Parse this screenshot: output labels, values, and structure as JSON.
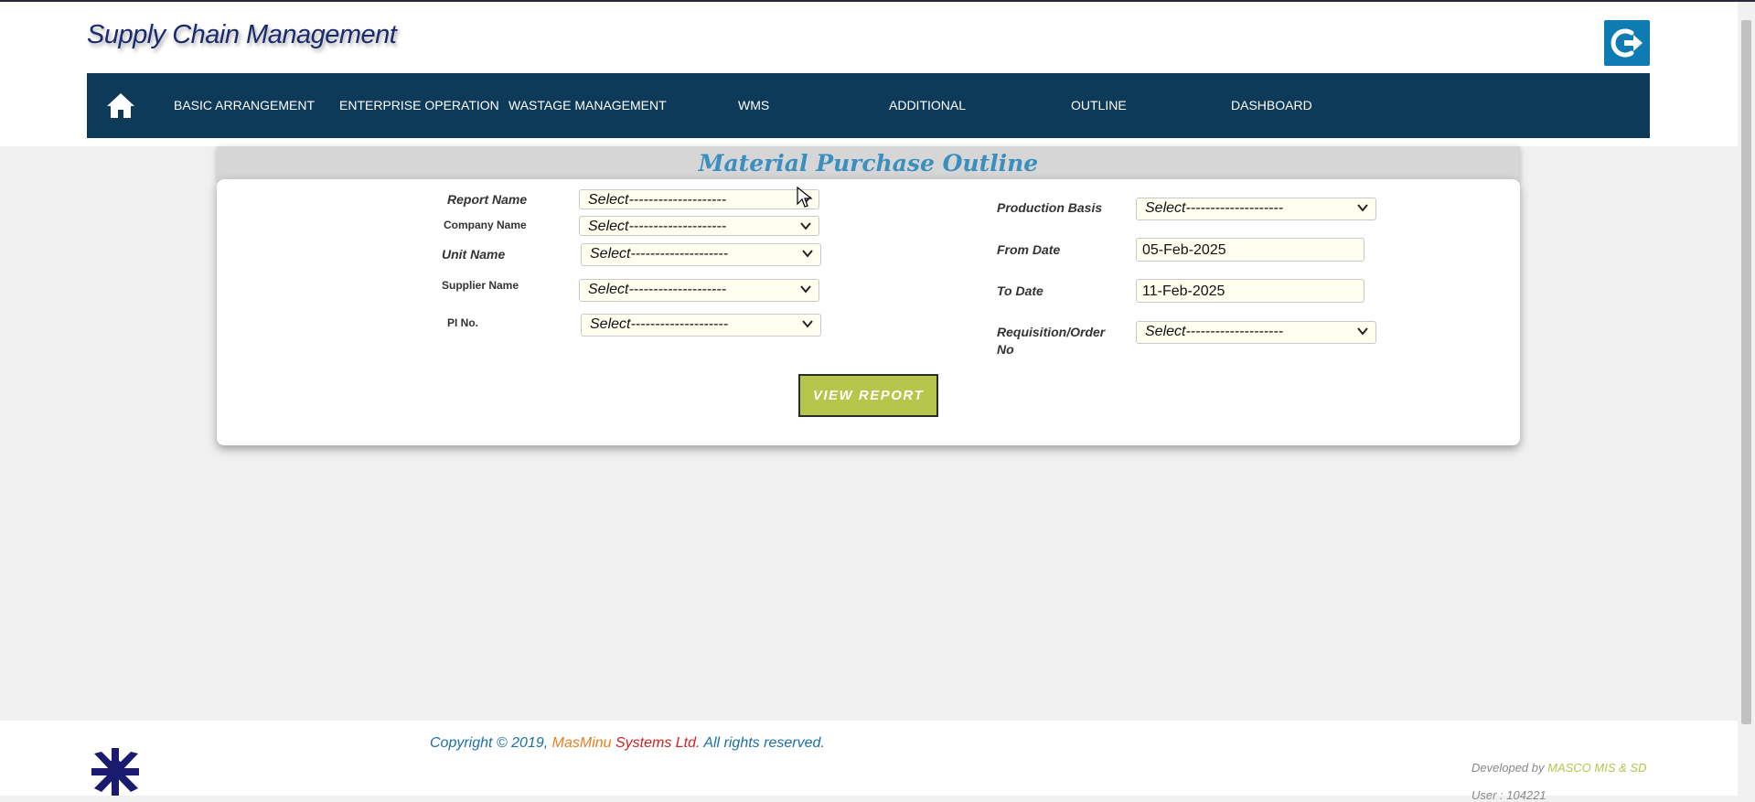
{
  "app": {
    "title": "Supply Chain Management"
  },
  "nav": {
    "items": [
      {
        "label": "BASIC ARRANGEMENT"
      },
      {
        "label": "ENTERPRISE OPERATION"
      },
      {
        "label": "WASTAGE MANAGEMENT"
      },
      {
        "label": "WMS"
      },
      {
        "label": "ADDITIONAL"
      },
      {
        "label": "OUTLINE"
      },
      {
        "label": "DASHBOARD"
      }
    ]
  },
  "form": {
    "title": "Material Purchase Outline",
    "left_fields": [
      {
        "label": "Report Name",
        "value": "Select--------------------"
      },
      {
        "label": "Company Name",
        "value": "Select--------------------"
      },
      {
        "label": "Unit Name",
        "value": "Select--------------------"
      },
      {
        "label": "Supplier Name",
        "value": "Select--------------------"
      },
      {
        "label": "PI No.",
        "value": "Select--------------------"
      }
    ],
    "production_basis": {
      "label": "Production Basis",
      "value": "Select--------------------"
    },
    "from_date": {
      "label": "From Date",
      "value": "05-Feb-2025"
    },
    "to_date": {
      "label": "To Date",
      "value": "11-Feb-2025"
    },
    "requisition": {
      "label": "Requisition/Order No",
      "value": "Select--------------------"
    },
    "submit_label": "VIEW REPORT"
  },
  "footer": {
    "copyright_prefix": "Copyright © 2019, ",
    "brand_a": "MasMinu",
    "brand_b": " Systems Ltd.",
    "copyright_suffix": " All rights reserved.",
    "developed_by_prefix": "Developed by ",
    "developed_by_org": "MASCO MIS & SD",
    "user_line": "User : 104221"
  },
  "colors": {
    "navbar": "#0e3a5a",
    "accent": "#0e7bb3",
    "button": "#b5c64a",
    "title": "#3a8fbf"
  },
  "icons": {
    "home": "home-icon",
    "logout": "logout-icon",
    "chevron": "chevron-down-icon",
    "logo": "snowflake-logo-icon"
  }
}
